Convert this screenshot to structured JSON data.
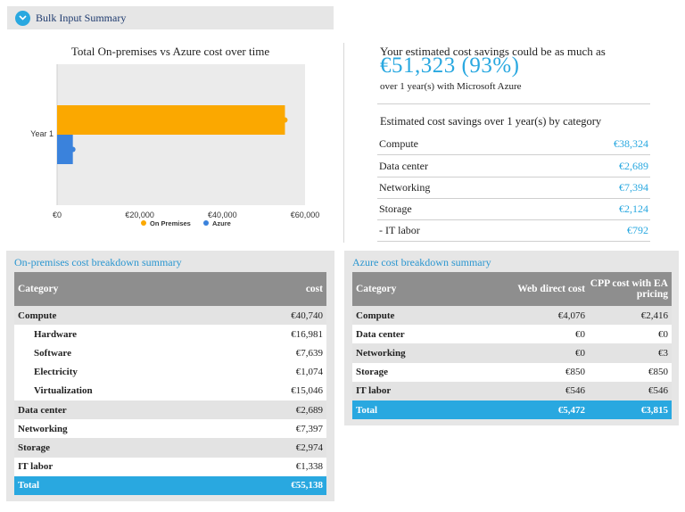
{
  "bulk_input": {
    "label": "Bulk Input Summary"
  },
  "chart": {
    "title": "Total On-premises vs Azure cost over time",
    "colors": {
      "on_premises": "#fba800",
      "azure": "#3a82dc"
    }
  },
  "chart_data": {
    "type": "bar",
    "orientation": "horizontal",
    "title": "Total On-premises vs Azure cost over time",
    "categories": [
      "Year 1"
    ],
    "series": [
      {
        "name": "On Premises",
        "values": [
          55138
        ]
      },
      {
        "name": "Azure",
        "values": [
          3815
        ]
      }
    ],
    "xlim": [
      0,
      60000
    ],
    "xticks": [
      "€0",
      "€20,000",
      "€40,000",
      "€60,000"
    ],
    "legend": "bottom",
    "grid": false
  },
  "savings": {
    "headline": "Your estimated cost savings could be as much as",
    "amount": "€51,323 (93%)",
    "subtext": "over 1 year(s) with Microsoft Azure",
    "category_title": "Estimated cost savings over 1 year(s) by category",
    "categories": [
      {
        "name": "Compute",
        "value": "€38,324"
      },
      {
        "name": "Data center",
        "value": "€2,689"
      },
      {
        "name": "Networking",
        "value": "€7,394"
      },
      {
        "name": "Storage",
        "value": "€2,124"
      },
      {
        "name": "- IT labor",
        "value": "€792"
      }
    ]
  },
  "onprem": {
    "title": "On-premises cost breakdown summary",
    "headers": [
      "Category",
      "cost"
    ],
    "rows": [
      {
        "label": "Compute",
        "value": "€40,740"
      },
      {
        "label": "Hardware",
        "value": "€16,981"
      },
      {
        "label": "Software",
        "value": "€7,639"
      },
      {
        "label": "Electricity",
        "value": "€1,074"
      },
      {
        "label": "Virtualization",
        "value": "€15,046"
      },
      {
        "label": "Data center",
        "value": "€2,689"
      },
      {
        "label": "Networking",
        "value": "€7,397"
      },
      {
        "label": "Storage",
        "value": "€2,974"
      },
      {
        "label": "IT labor",
        "value": "€1,338"
      },
      {
        "label": "Total",
        "value": "€55,138"
      }
    ]
  },
  "azure": {
    "title": "Azure cost breakdown summary",
    "headers": [
      "Category",
      "Web direct cost",
      "CPP cost with EA pricing"
    ],
    "rows": [
      {
        "label": "Compute",
        "web": "€4,076",
        "cpp": "€2,416"
      },
      {
        "label": "Data center",
        "web": "€0",
        "cpp": "€0"
      },
      {
        "label": "Networking",
        "web": "€0",
        "cpp": "€3"
      },
      {
        "label": "Storage",
        "web": "€850",
        "cpp": "€850"
      },
      {
        "label": "IT labor",
        "web": "€546",
        "cpp": "€546"
      },
      {
        "label": "Total",
        "web": "€5,472",
        "cpp": "€3,815"
      }
    ]
  }
}
